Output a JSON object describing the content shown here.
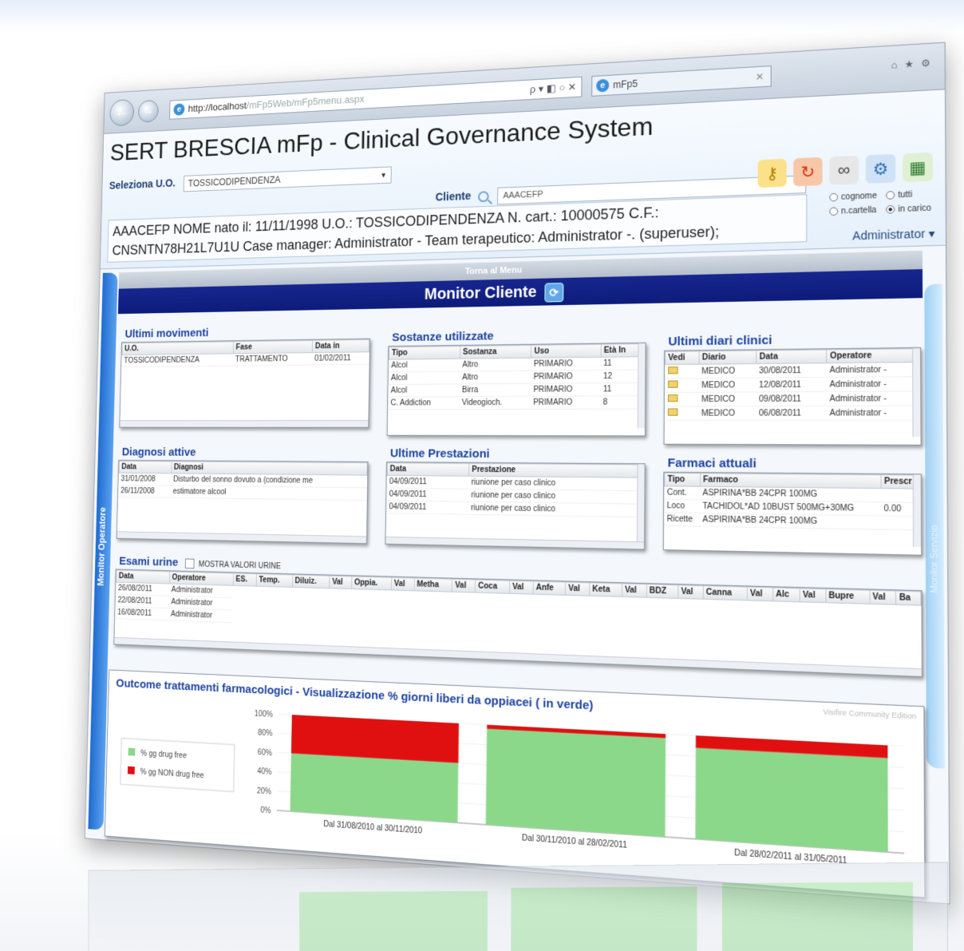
{
  "browser": {
    "url_host": "http://localhost",
    "url_path": "/mFp5Web/mFp5menu.aspx",
    "addr_controls": "ρ ▾ ◧ ○ ✕",
    "tab_title": "mFp5"
  },
  "app": {
    "title": "SERT BRESCIA mFp - Clinical Governance System",
    "uo_label": "Seleziona U.O.",
    "uo_value": "TOSSICODIPENDENZA",
    "cliente_label": "Cliente",
    "cliente_value": "AAACEFP",
    "patient_line1": "AAACEFP NOME nato il: 11/11/1998 U.O.: TOSSICODIPENDENZA N. cart.: 10000575 C.F.:",
    "patient_line2": "CNSNTN78H21L7U1U Case manager: Administrator - Team terapeutico: Administrator -. (superuser);",
    "radios": [
      "cognome",
      "tutti",
      "n.cartella",
      "in carico"
    ],
    "user": "Administrator"
  },
  "nav": {
    "left_tab": "Monitor Operatore",
    "right_tab": "Monitor Servizio",
    "back_to_menu": "Torna al Menu",
    "monitor_title": "Monitor Cliente"
  },
  "movimenti": {
    "title": "Ultimi movimenti",
    "headers": [
      "U.O.",
      "Fase",
      "Data in"
    ],
    "rows": [
      [
        "TOSSICODIPENDENZA",
        "TRATTAMENTO",
        "01/02/2011"
      ]
    ]
  },
  "sostanze": {
    "title": "Sostanze utilizzate",
    "headers": [
      "Tipo",
      "Sostanza",
      "Uso",
      "Età In"
    ],
    "rows": [
      [
        "Alcol",
        "Altro",
        "PRIMARIO",
        "11"
      ],
      [
        "Alcol",
        "Altro",
        "PRIMARIO",
        "12"
      ],
      [
        "Alcol",
        "Birra",
        "PRIMARIO",
        "11"
      ],
      [
        "C. Addiction",
        "Videogioch.",
        "PRIMARIO",
        "8"
      ]
    ]
  },
  "diari": {
    "title": "Ultimi diari clinici",
    "headers": [
      "Vedi",
      "Diario",
      "Data",
      "Operatore"
    ],
    "rows": [
      [
        "MEDICO",
        "30/08/2011",
        "Administrator -"
      ],
      [
        "MEDICO",
        "12/08/2011",
        "Administrator -"
      ],
      [
        "MEDICO",
        "09/08/2011",
        "Administrator -"
      ],
      [
        "MEDICO",
        "06/08/2011",
        "Administrator -"
      ]
    ]
  },
  "diagnosi": {
    "title": "Diagnosi attive",
    "headers": [
      "Data",
      "Diagnosi"
    ],
    "rows": [
      [
        "31/01/2008",
        "Disturbo del sonno dovuto a (condizione me"
      ],
      [
        "26/11/2008",
        "estimatore alcool"
      ]
    ]
  },
  "prestazioni": {
    "title": "Ultime Prestazioni",
    "headers": [
      "Data",
      "Prestazione"
    ],
    "rows": [
      [
        "04/09/2011",
        "riunione per caso clinico"
      ],
      [
        "04/09/2011",
        "riunione per caso clinico"
      ],
      [
        "04/09/2011",
        "riunione per caso clinico"
      ]
    ]
  },
  "farmaci": {
    "title": "Farmaci attuali",
    "headers": [
      "Tipo",
      "Farmaco",
      "Prescr"
    ],
    "rows": [
      [
        "Cont.",
        "ASPIRINA*BB 24CPR 100MG",
        ""
      ],
      [
        "Loco",
        "TACHIDOL*AD 10BUST 500MG+30MG",
        "0.00"
      ],
      [
        "Ricette",
        "ASPIRINA*BB 24CPR 100MG",
        ""
      ]
    ]
  },
  "urine": {
    "title": "Esami urine",
    "checkbox_label": "MOSTRA VALORI URINE",
    "headers": [
      "Data",
      "Operatore",
      "ES.",
      "Temp.",
      "Diluiz.",
      "Val",
      "Oppia.",
      "Val",
      "Metha",
      "Val",
      "Coca",
      "Val",
      "Anfe",
      "Val",
      "Keta",
      "Val",
      "BDZ",
      "Val",
      "Canna",
      "Val",
      "Alc",
      "Val",
      "Bupre",
      "Val",
      "Ba"
    ],
    "rows": [
      [
        "26/08/2011",
        "Administrator"
      ],
      [
        "22/08/2011",
        "Administrator"
      ],
      [
        "16/08/2011",
        "Administrator"
      ]
    ]
  },
  "outcome": {
    "title": "Outcome trattamenti farmacologici - Visualizzazione % giorni liberi da oppiacei ( in verde)",
    "watermark": "Visifire Community Edition"
  },
  "chart_data": {
    "type": "bar",
    "stacked": true,
    "categories": [
      "Dal 31/08/2010 al 30/11/2010",
      "Dal 30/11/2010 al 28/02/2011",
      "Dal 28/02/2011 al 31/05/2011"
    ],
    "series": [
      {
        "name": "% gg drug free",
        "values": [
          60,
          96,
          88
        ],
        "color": "#8bd88b"
      },
      {
        "name": "% gg NON drug free",
        "values": [
          40,
          4,
          12
        ],
        "color": "#e01010"
      }
    ],
    "ylim": [
      0,
      100
    ],
    "yticks": [
      "100%",
      "80%",
      "60%",
      "40%",
      "20%",
      "0%"
    ],
    "legend": "left"
  }
}
